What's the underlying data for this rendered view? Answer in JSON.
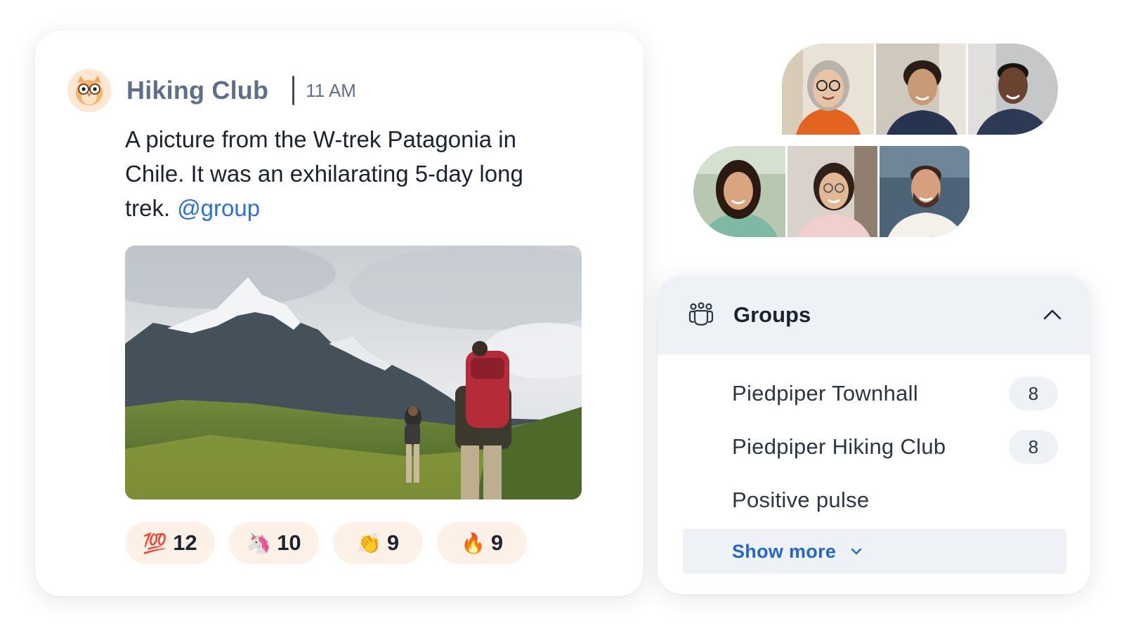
{
  "post": {
    "author": "Hiking Club",
    "time": "11 AM",
    "avatar_icon": "owl-avatar-icon",
    "body_text": "A picture from the W-trek Patagonia in Chile. It was an exhilarating 5-day long trek.",
    "mention": "@group",
    "photo": "mountain-hikers-photo",
    "reactions": [
      {
        "emoji": "💯",
        "icon": "hundred-points-icon",
        "count": "12"
      },
      {
        "emoji": "🦄",
        "icon": "unicorn-icon",
        "count": "10"
      },
      {
        "emoji": "👏",
        "icon": "clapping-hands-icon",
        "count": "9"
      },
      {
        "emoji": "🔥",
        "icon": "fire-icon",
        "count": "9"
      }
    ]
  },
  "participants": {
    "top_row": [
      "participant-photo-1",
      "participant-photo-2",
      "participant-photo-3"
    ],
    "bottom_row": [
      "participant-photo-4",
      "participant-photo-5",
      "participant-photo-6"
    ]
  },
  "groups": {
    "title": "Groups",
    "icon": "people-group-icon",
    "items": [
      {
        "name": "Piedpiper Townhall",
        "count": "8"
      },
      {
        "name": "Piedpiper Hiking Club",
        "count": "8"
      },
      {
        "name": "Positive pulse",
        "count": ""
      }
    ],
    "show_more": "Show more"
  },
  "colors": {
    "accent_link": "#2567c9",
    "mention": "#2e6fd6",
    "reaction_bg": "#fdf0e6",
    "panel_header_bg": "#eef2f6",
    "club_name": "#5d7088"
  }
}
